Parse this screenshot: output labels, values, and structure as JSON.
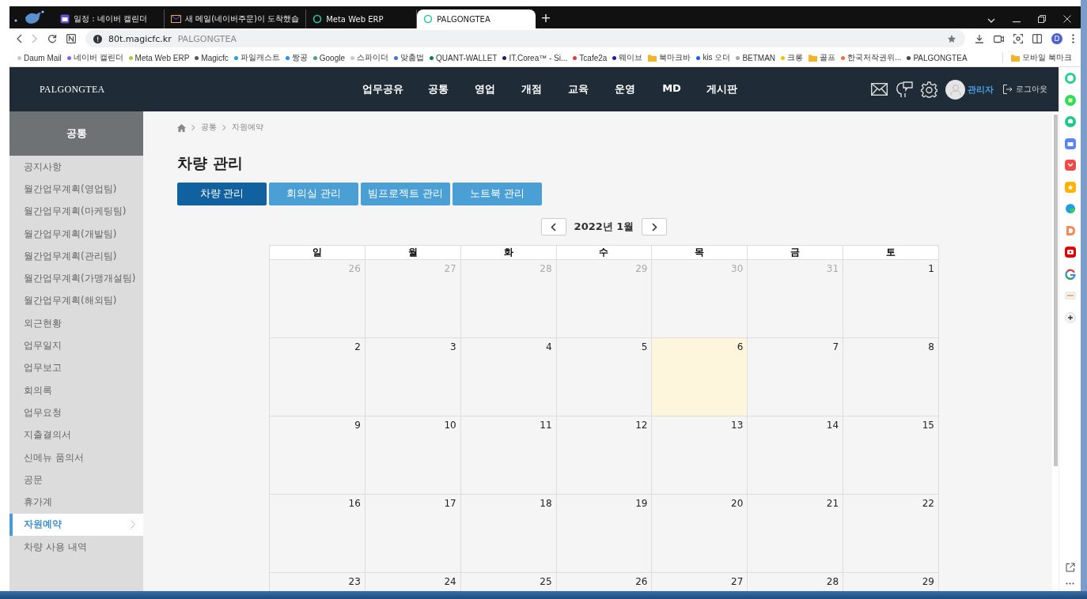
{
  "browser": {
    "tabs": [
      {
        "title": "일정 : 네이버 캘린더",
        "selected": false
      },
      {
        "title": "새 메일(네이버주문)이 도착했습",
        "selected": false
      },
      {
        "title": "Meta Web ERP",
        "selected": false
      },
      {
        "title": "PALGONGTEA",
        "selected": true
      }
    ],
    "new_tab": "+",
    "address": {
      "url": "80t.magicfc.kr",
      "page_title": "PALGONGTEA"
    },
    "profile": "D",
    "bookmarks": [
      {
        "label": "Daum Mail",
        "kind": "site",
        "color": "#c8c8c8"
      },
      {
        "label": "네이버 캘린더",
        "kind": "site",
        "color": "#8a5cf6"
      },
      {
        "label": "Meta Web ERP",
        "kind": "site",
        "color": "#b5c62a"
      },
      {
        "label": "Magicfc",
        "kind": "site",
        "color": "#555555"
      },
      {
        "label": "파일캐스트",
        "kind": "site",
        "color": "#1aa3e0"
      },
      {
        "label": "짱공",
        "kind": "site",
        "color": "#1e8cff"
      },
      {
        "label": "Google",
        "kind": "site",
        "color": "#4aa08a"
      },
      {
        "label": "스파이더",
        "kind": "site",
        "color": "#c8c8c8"
      },
      {
        "label": "맞춤법",
        "kind": "site",
        "color": "#4a6fd0"
      },
      {
        "label": "QUANT-WALLET",
        "kind": "site",
        "color": "#0a7a5a"
      },
      {
        "label": "IT.Corea™ - Si...",
        "kind": "site",
        "color": "#222255"
      },
      {
        "label": "Tcafe2a",
        "kind": "site",
        "color": "#e03a3a"
      },
      {
        "label": "웨이브",
        "kind": "site",
        "color": "#1a1ab0"
      },
      {
        "label": "북마크바",
        "kind": "folder"
      },
      {
        "label": "kis 오더",
        "kind": "site",
        "color": "#1a5cff"
      },
      {
        "label": "BETMAN",
        "kind": "site",
        "color": "#aaaaaa"
      },
      {
        "label": "크롱",
        "kind": "site",
        "color": "#f2c200"
      },
      {
        "label": "골프",
        "kind": "folder"
      },
      {
        "label": "한국저작권위...",
        "kind": "site",
        "color": "#f07040"
      },
      {
        "label": "PALGONGTEA",
        "kind": "site",
        "color": "#444444"
      }
    ],
    "mobile_bookmarks": "모바일 북마크"
  },
  "header": {
    "logo": "PALGONGTEA",
    "nav": [
      "업무공유",
      "공통",
      "영업",
      "개점",
      "교육",
      "운영",
      "MD",
      "게시판"
    ],
    "user": "관리자",
    "logout": "로그아웃"
  },
  "sidebar": {
    "title": "공통",
    "items": [
      {
        "label": "공지사항",
        "selected": false
      },
      {
        "label": "월간업무계획(영업팀)",
        "selected": false
      },
      {
        "label": "월간업무계획(마케팅팀)",
        "selected": false
      },
      {
        "label": "월간업무계획(개발팀)",
        "selected": false
      },
      {
        "label": "월간업무계획(관리팀)",
        "selected": false
      },
      {
        "label": "월간업무계획(가맹개설팀)",
        "selected": false
      },
      {
        "label": "월간업무계획(해외팀)",
        "selected": false
      },
      {
        "label": "외근현황",
        "selected": false
      },
      {
        "label": "업무일지",
        "selected": false
      },
      {
        "label": "업무보고",
        "selected": false
      },
      {
        "label": "회의록",
        "selected": false
      },
      {
        "label": "업무요청",
        "selected": false
      },
      {
        "label": "지출결의서",
        "selected": false
      },
      {
        "label": "신메뉴 품의서",
        "selected": false
      },
      {
        "label": "공문",
        "selected": false
      },
      {
        "label": "휴가계",
        "selected": false
      },
      {
        "label": "자원예약",
        "selected": true
      },
      {
        "label": "차량 사용 내역",
        "selected": false
      }
    ]
  },
  "breadcrumb": [
    "공통",
    "자원예약"
  ],
  "page_title": "차량 관리",
  "resource_tabs": [
    {
      "label": "차량 관리",
      "selected": true
    },
    {
      "label": "회의실 관리",
      "selected": false
    },
    {
      "label": "빔프로젝트 관리",
      "selected": false
    },
    {
      "label": "노트북 관리",
      "selected": false
    }
  ],
  "calendar": {
    "month": "2022년 1월",
    "weekdays": [
      "일",
      "월",
      "화",
      "수",
      "목",
      "금",
      "토"
    ],
    "weeks": [
      [
        {
          "day": "26",
          "other_month": true,
          "today": false
        },
        {
          "day": "27",
          "other_month": true,
          "today": false
        },
        {
          "day": "28",
          "other_month": true,
          "today": false
        },
        {
          "day": "29",
          "other_month": true,
          "today": false
        },
        {
          "day": "30",
          "other_month": true,
          "today": false
        },
        {
          "day": "31",
          "other_month": true,
          "today": false
        },
        {
          "day": "1",
          "other_month": false,
          "today": false
        }
      ],
      [
        {
          "day": "2",
          "other_month": false,
          "today": false
        },
        {
          "day": "3",
          "other_month": false,
          "today": false
        },
        {
          "day": "4",
          "other_month": false,
          "today": false
        },
        {
          "day": "5",
          "other_month": false,
          "today": false
        },
        {
          "day": "6",
          "other_month": false,
          "today": true
        },
        {
          "day": "7",
          "other_month": false,
          "today": false
        },
        {
          "day": "8",
          "other_month": false,
          "today": false
        }
      ],
      [
        {
          "day": "9",
          "other_month": false,
          "today": false
        },
        {
          "day": "10",
          "other_month": false,
          "today": false
        },
        {
          "day": "11",
          "other_month": false,
          "today": false
        },
        {
          "day": "12",
          "other_month": false,
          "today": false
        },
        {
          "day": "13",
          "other_month": false,
          "today": false
        },
        {
          "day": "14",
          "other_month": false,
          "today": false
        },
        {
          "day": "15",
          "other_month": false,
          "today": false
        }
      ],
      [
        {
          "day": "16",
          "other_month": false,
          "today": false
        },
        {
          "day": "17",
          "other_month": false,
          "today": false
        },
        {
          "day": "18",
          "other_month": false,
          "today": false
        },
        {
          "day": "19",
          "other_month": false,
          "today": false
        },
        {
          "day": "20",
          "other_month": false,
          "today": false
        },
        {
          "day": "21",
          "other_month": false,
          "today": false
        },
        {
          "day": "22",
          "other_month": false,
          "today": false
        }
      ],
      [
        {
          "day": "23",
          "other_month": false,
          "today": false
        },
        {
          "day": "24",
          "other_month": false,
          "today": false
        },
        {
          "day": "25",
          "other_month": false,
          "today": false
        },
        {
          "day": "26",
          "other_month": false,
          "today": false
        },
        {
          "day": "27",
          "other_month": false,
          "today": false
        },
        {
          "day": "28",
          "other_month": false,
          "today": false
        },
        {
          "day": "29",
          "other_month": false,
          "today": false
        }
      ]
    ]
  }
}
